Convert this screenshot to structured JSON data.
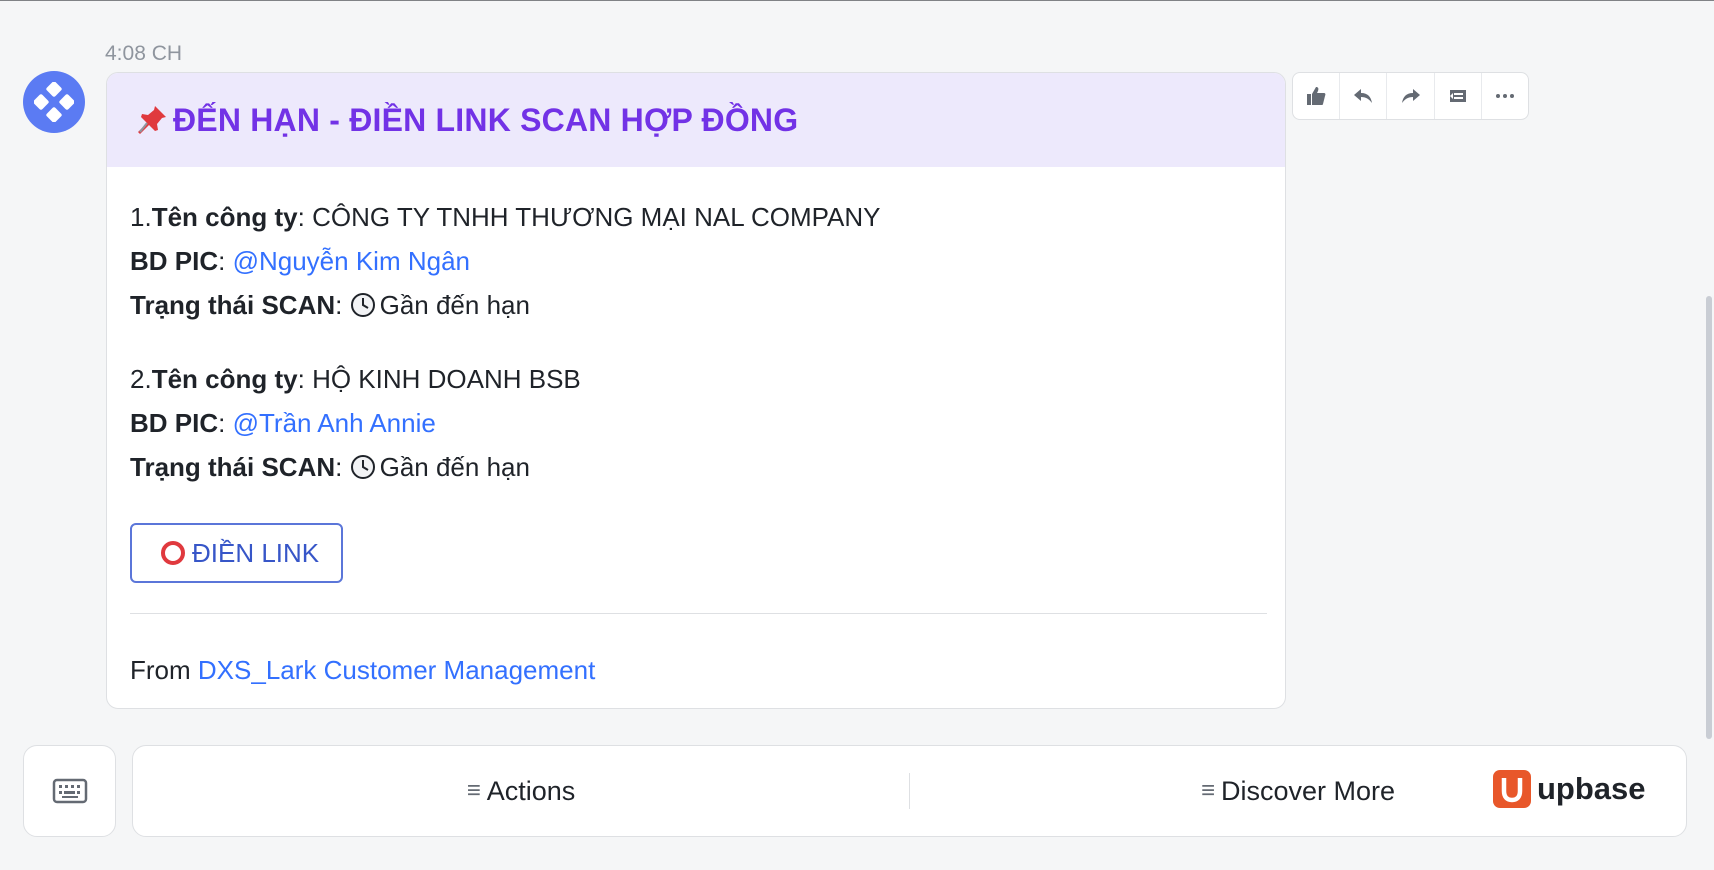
{
  "message": {
    "timestamp": "4:08 CH",
    "card": {
      "title": "ĐẾN HẠN - ĐIỀN LINK SCAN HỢP ĐỒNG",
      "header_color": "#ede9fc",
      "title_color": "#7232e6",
      "entries": [
        {
          "index": "1.",
          "company_label": "Tên công ty",
          "company_value": "CÔNG TY TNHH THƯƠNG MẠI NAL COMPANY",
          "pic_label": "BD PIC",
          "pic_value": "@Nguyễn Kim Ngân",
          "status_label": "Trạng thái SCAN",
          "status_value": "Gần đến hạn"
        },
        {
          "index": "2.",
          "company_label": "Tên công ty",
          "company_value": "HỘ KINH DOANH BSB",
          "pic_label": "BD PIC",
          "pic_value": "@Trần Anh Annie",
          "status_label": "Trạng thái SCAN",
          "status_value": "Gần đến hạn"
        }
      ],
      "colon": ":",
      "button_label": "ĐIỀN LINK",
      "from_prefix": "From",
      "from_source": "DXS_Lark Customer Management"
    }
  },
  "toolbar": {
    "icons": [
      "thumbs-up-icon",
      "reply-icon",
      "forward-icon",
      "quote-icon",
      "more-icon"
    ]
  },
  "bottom_bar": {
    "actions_label": "Actions",
    "discover_label": "Discover More",
    "menu_icon": "≡",
    "brand_text": "upbase",
    "brand_color": "#e8572a"
  }
}
